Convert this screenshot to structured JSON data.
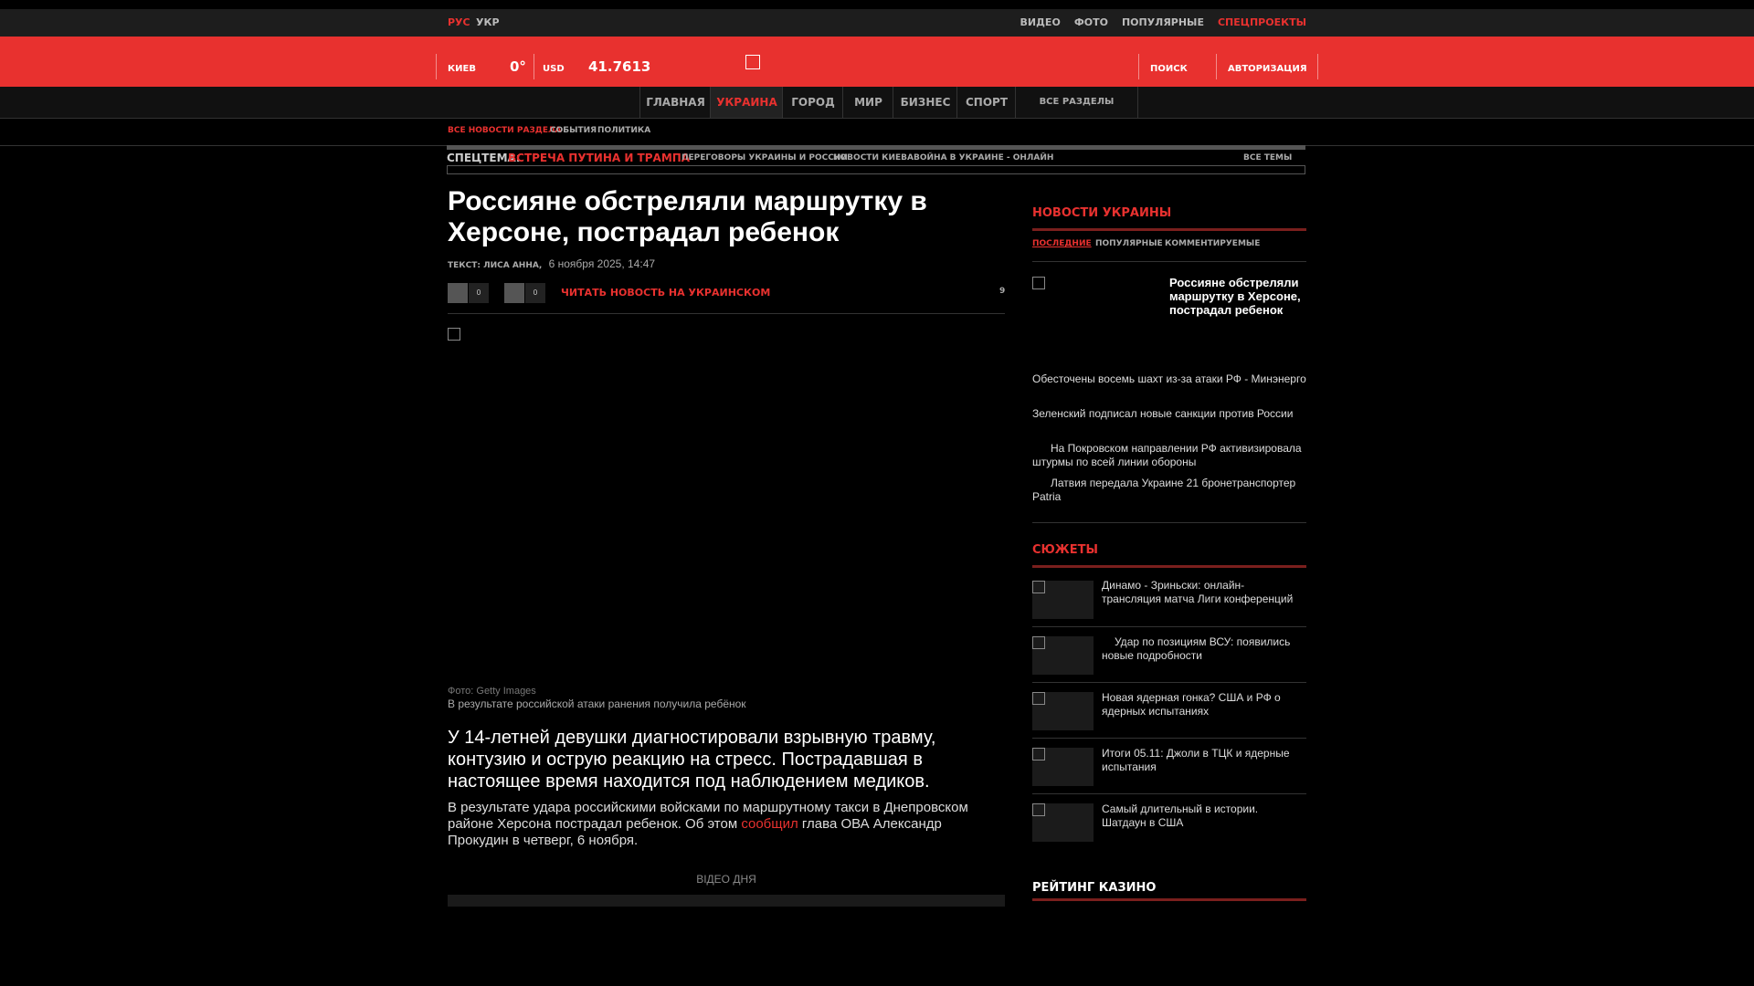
{
  "header": {
    "lang": [
      "РУС",
      "УКР"
    ],
    "topnav": [
      "ВИДЕО",
      "ФОТО",
      "ПОПУЛЯРНЫЕ",
      "СПЕЦПРОЕКТЫ"
    ],
    "city": "КИЕВ",
    "temperature": "0°",
    "currency": "USD",
    "rate": "41.7613",
    "search": "ПОИСК",
    "auth": "АВТОРИЗАЦИЯ"
  },
  "nav": {
    "items": [
      "ГЛАВНАЯ",
      "УКРАИНА",
      "ГОРОД",
      "МИР",
      "БИЗНЕС",
      "СПОРТ"
    ],
    "all": "ВСЕ РАЗДЕЛЫ"
  },
  "subnav": [
    "ВСЕ НОВОСТИ РАЗДЕЛА",
    "СОБЫТИЯ",
    "ПОЛИТИКА"
  ],
  "spec": {
    "label": "СПЕЦТЕМА:",
    "main": "ВСТРЕЧА ПУТИНА И ТРАМПА",
    "items": [
      "ПЕРЕГОВОРЫ УКРАИНЫ И РОССИИ",
      "НОВОСТИ КИЕВА",
      "ВОЙНА В УКРАИНЕ - ОНЛАЙН"
    ],
    "all": "ВСЕ ТЕМЫ"
  },
  "article": {
    "title": "Россияне обстреляли маршрутку в Херсоне, пострадал ребенок",
    "author": "ТЕКСТ: ЛИСА АННА,",
    "date": "6 ноября 2025, 14:47",
    "share_counts": [
      "0",
      "0"
    ],
    "read_ua": "ЧИТАТЬ НОВОСТЬ НА УКРАИНСКОМ",
    "comments": "9",
    "photo_credit": "Фото: Getty Images",
    "caption": "В результате российской атаки ранения получила ребёнок",
    "lead": "У 14-летней девушки диагностировали взрывную травму, контузию и острую реакцию на стресс. Пострадавшая в настоящее время находится под наблюдением медиков.",
    "body_before": "В результате удара российскими войсками по маршрутному такси в Днепровском районе Херсона пострадал ребенок. Об этом ",
    "body_link": "сообщил",
    "body_after": " глава ОВА Александр Прокудин в четверг, 6 ноября.",
    "video_label": "ВІДЕО ДНЯ"
  },
  "sidebar": {
    "news_title": "НОВОСТИ УКРАИНЫ",
    "tabs": [
      "ПОСЛЕДНИЕ",
      "ПОПУЛЯРНЫЕ",
      "КОММЕНТИРУЕМЫЕ"
    ],
    "featured": "Россияне обстреляли маршрутку в Херсоне, пострадал ребенок",
    "news": [
      "Обесточены восемь шахт из-за атаки РФ - Минэнерго",
      "Зеленский подписал новые санкции против России",
      "На Покровском направлении РФ активизировала штурмы по всей линии обороны",
      "Латвия передала Украине 21 бронетранспортер Patria"
    ],
    "stories_title": "СЮЖЕТЫ",
    "stories": [
      "Динамо - Зриньски: онлайн-трансляция матча Лиги конференций",
      "Удар по позициям ВСУ: появились новые подробности",
      "Новая ядерная гонка? США и РФ о ядерных испытаниях",
      "Итоги 05.11: Джоли в ТЦК и ядерные испытания",
      "Самый длительный в истории. Шатдаун в США"
    ],
    "rating_title": "РЕЙТИНГ КАЗИНО"
  }
}
